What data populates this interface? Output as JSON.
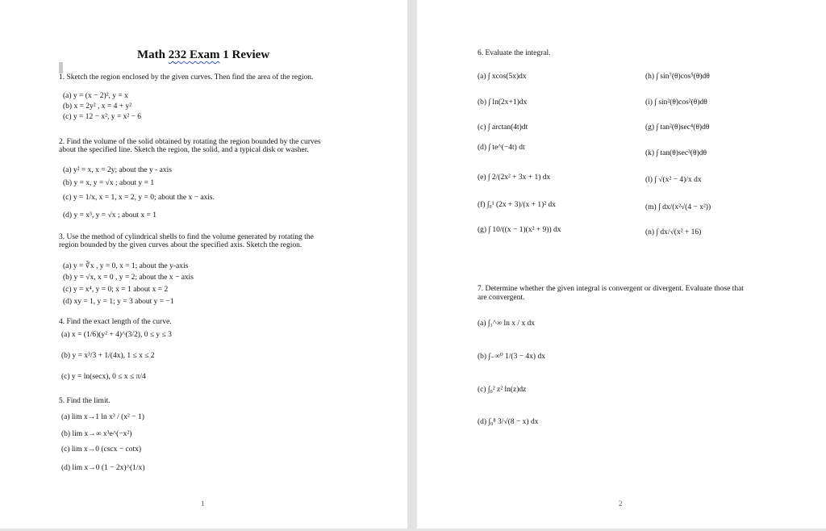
{
  "document": {
    "title_prefix": "Math ",
    "title_word": "232 Exam",
    "title_suffix": " 1 Review",
    "page_numbers": [
      "1",
      "2"
    ]
  },
  "problems": {
    "p1": {
      "prompt": "1. Sketch the region enclosed by the given curves. Then find the area of the region.",
      "items": [
        "(a) y = (x − 2)², y = x",
        "(b) x = 2y² , x = 4 + y²",
        "(c) y = 12 − x², y = x² − 6"
      ]
    },
    "p2": {
      "prompt_line1": "2. Find the volume of the solid obtained by rotating the region bounded by the curves",
      "prompt_line2": "about the specified line. Sketch the region, the solid, and a typical disk or washer.",
      "items": [
        "(a) y² = x, x = 2y; about the y - axis",
        "(b) y = x, y = √x ; about y = 1",
        "(c) y = 1/x, x = 1, x = 2, y = 0; about the x − axis.",
        "(d) y = x³, y = √x ; about x = 1"
      ]
    },
    "p3": {
      "prompt_line1": "3. Use the method of cylindrical shells to find the volume generated by rotating the",
      "prompt_line2": "region bounded by the given curves about the specified axis. Sketch the region.",
      "items": [
        "(a) y = ∛x , y = 0, x = 1; about the y-axis",
        "(b) y = √x, x = 0 , y = 2; about the x − axis",
        "(c) y = x⁴, y = 0; x = 1 about x = 2",
        "(d) xy = 1, y = 1; y = 3 about y = −1"
      ]
    },
    "p4": {
      "prompt": "4. Find the exact length of the curve.",
      "items": [
        "(a) x = (1/6)(y² + 4)^(3/2), 0 ≤ y ≤ 3",
        "(b) y = x³/3 + 1/(4x), 1 ≤ x ≤ 2",
        "(c) y = ln(secx), 0 ≤ x ≤ π/4"
      ]
    },
    "p5": {
      "prompt": "5. Find the limit.",
      "items": [
        "(a) lim x→1 ln x³ / (x² − 1)",
        "(b) lim x→∞ x³e^(−x²)",
        "(c) lim x→0 (cscx − cotx)",
        "(d) lim x→0 (1 − 2x)^(1/x)"
      ]
    },
    "p6": {
      "prompt": "6. Evaluate the integral.",
      "left_items": [
        "(a) ∫ xcos(5x)dx",
        "(b) ∫ ln(2x+1)dx",
        "(c) ∫ arctan(4t)dt",
        "(d) ∫ te^(−4t) dt",
        "(e) ∫ 2/(2x² + 3x + 1) dx",
        "(f) ∫₀¹ (2x + 3)/(x + 1)² dx",
        "(g) ∫ 10/((x − 1)(x² + 9)) dx"
      ],
      "right_items": [
        "(h) ∫ sin⁷(θ)cos⁵(θ)dθ",
        "(i) ∫ sin²(θ)cos²(θ)dθ",
        "(g) ∫ tan²(θ)sec⁴(θ)dθ",
        "(k) ∫ tan(θ)sec³(θ)dθ",
        "(l) ∫ √(x² − 4)/x dx",
        "(m) ∫ dx/(x²√(4 − x²))",
        "(n) ∫ dx/√(x² + 16)"
      ]
    },
    "p7": {
      "prompt_line1": "7. Determine whether the given integral is convergent or divergent.  Evaluate those that",
      "prompt_line2": "are convergent.",
      "items": [
        "(a) ∫₁^∞ ln x / x dx",
        "(b) ∫₋∞⁰ 1/(3 − 4x) dx",
        "(c) ∫₀² z² ln(z)dz",
        "(d) ∫₀⁸ 3/√(8 − x) dx"
      ]
    }
  },
  "labels": {
    "a": "(a)",
    "b": "(b)",
    "c": "(c)",
    "d": "(d)",
    "e": "(e)",
    "f": "(f)",
    "g": "(g)",
    "h": "(h)",
    "i": "(i)",
    "k": "(k)",
    "l": "(l)",
    "m": "(m)",
    "n": "(n)"
  }
}
